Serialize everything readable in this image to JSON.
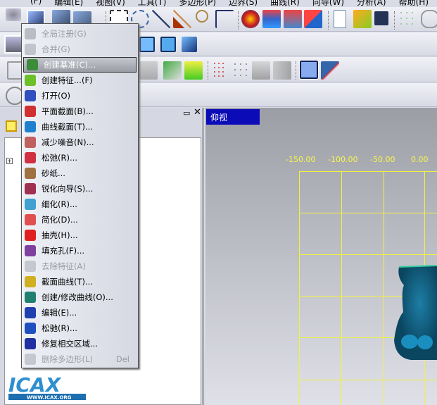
{
  "menubar": [
    "(F)",
    "编辑(E)",
    "视图(V)",
    "工具(T)",
    "多边形(P)",
    "边界(S)",
    "曲线(R)",
    "向导(W)",
    "分析(A)",
    "帮助(H)"
  ],
  "menu": {
    "items": [
      {
        "label": "全局注册(G)",
        "disabled": true,
        "icon": "global-register-icon",
        "color": "#8a8c94"
      },
      {
        "label": "合并(G)",
        "disabled": true,
        "icon": "merge-icon",
        "color": "#9a9ca4"
      },
      {
        "label": "创建基准(C)...",
        "selected": true,
        "icon": "create-datum-icon",
        "color": "#3c8c3c"
      },
      {
        "label": "创建特征...(F)",
        "icon": "create-feature-icon",
        "color": "#6cc028"
      },
      {
        "label": "打开(O)",
        "icon": "open-icon",
        "color": "#3050c0"
      },
      {
        "label": "平面截面(B)...",
        "icon": "plane-section-icon",
        "color": "#d03030"
      },
      {
        "label": "曲线截面(T)...",
        "icon": "curve-section-icon",
        "color": "#2080d0"
      },
      {
        "label": "减少噪音(N)...",
        "icon": "reduce-noise-icon",
        "color": "#c06060"
      },
      {
        "label": "松弛(R)...",
        "icon": "relax-icon",
        "color": "#d03040"
      },
      {
        "label": "砂纸...",
        "icon": "sandpaper-icon",
        "color": "#a07040"
      },
      {
        "label": "锐化向导(S)...",
        "icon": "sharpen-wizard-icon",
        "color": "#a03050"
      },
      {
        "label": "细化(R)...",
        "icon": "refine-icon",
        "color": "#40a0d0"
      },
      {
        "label": "简化(D)...",
        "icon": "simplify-icon",
        "color": "#e05050"
      },
      {
        "label": "抽壳(H)...",
        "icon": "shell-icon",
        "color": "#e02020"
      },
      {
        "label": "填充孔(F)...",
        "icon": "fill-hole-icon",
        "color": "#8040a0"
      },
      {
        "label": "去除特征(A)",
        "disabled": true,
        "icon": "remove-feature-icon",
        "color": "#a0a2aa"
      },
      {
        "label": "截面曲线(T)...",
        "icon": "section-curve-icon",
        "color": "#d0b020"
      },
      {
        "label": "创建/修改曲线(O)...",
        "icon": "create-modify-curve-icon",
        "color": "#208070"
      },
      {
        "label": "编辑(E)...",
        "icon": "edit-icon",
        "color": "#2040b0"
      },
      {
        "label": "松驰(R)...",
        "icon": "relax-mesh-icon",
        "color": "#2050c0"
      },
      {
        "label": "修复相交区域...",
        "icon": "repair-intersection-icon",
        "color": "#2030a0"
      },
      {
        "label": "删除多边形(L)",
        "disabled": true,
        "shortcut": "Del",
        "icon": "delete-polygon-icon",
        "color": "#a0a2aa"
      }
    ]
  },
  "viewport": {
    "view_label": "仰视",
    "ticks": [
      "-150.00",
      "-100.00",
      "-50.00",
      "0.00"
    ],
    "model_color": "#0e5a78",
    "grid_color": "#f2f23c"
  },
  "logo": {
    "text": "ICAX",
    "url_text": "WWW.ICAX.ORG"
  }
}
